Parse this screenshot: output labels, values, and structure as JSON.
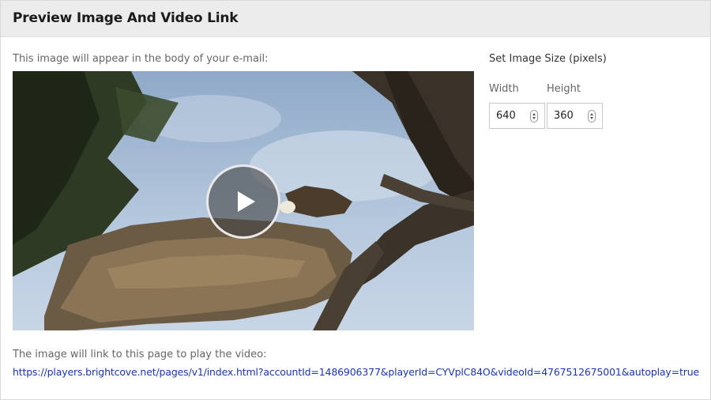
{
  "header": {
    "title": "Preview Image And Video Link"
  },
  "preview": {
    "caption": "This image will appear in the body of your e-mail:",
    "image": "eagle-nest-video-thumbnail",
    "play_icon": "play-icon"
  },
  "size_settings": {
    "title": "Set Image Size (pixels)",
    "width": {
      "label": "Width",
      "value": "640"
    },
    "height": {
      "label": "Height",
      "value": "360"
    }
  },
  "link": {
    "caption": "The image will link to this page to play the video:",
    "url": "https://players.brightcove.net/pages/v1/index.html?accountId=1486906377&playerId=CYVplC84O&videoId=4767512675001&autoplay=true"
  },
  "colors": {
    "header_bg": "#ececec",
    "link": "#1a35b8",
    "sky": "#a9bfd8"
  }
}
